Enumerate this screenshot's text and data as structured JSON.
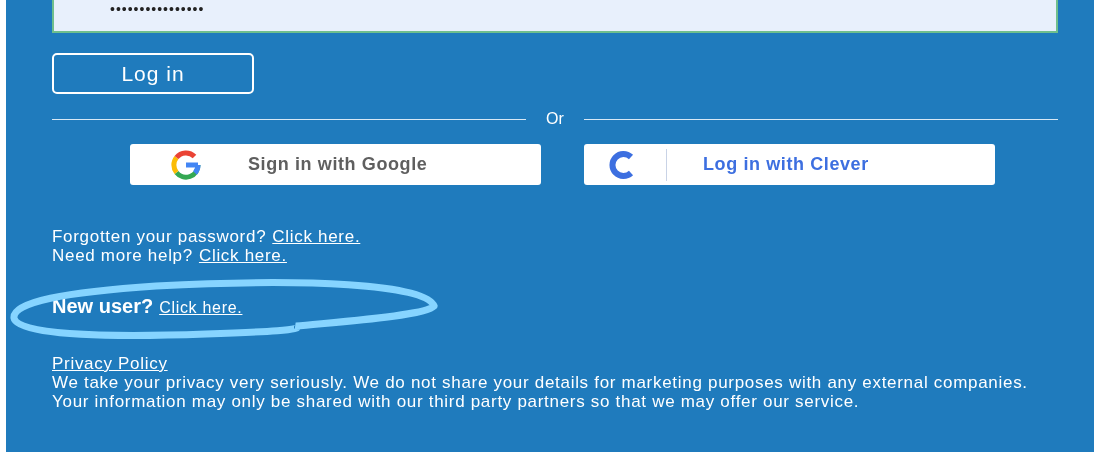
{
  "password_field": {
    "value": "••••••••••••••••"
  },
  "login_button": "Log in",
  "divider_label": "Or",
  "sso_buttons": [
    {
      "kind": "google",
      "label": "Sign in with Google"
    },
    {
      "kind": "clever",
      "label": "Log in with Clever"
    }
  ],
  "help_links": [
    {
      "text": "Forgotten your password?",
      "link": "Click here."
    },
    {
      "text": "Need more help?",
      "link": "Click here."
    }
  ],
  "new_user": {
    "text": "New user?",
    "link": "Click here."
  },
  "privacy": {
    "link": "Privacy Policy",
    "text": "We take your privacy very seriously. We do not share your details for marketing purposes with any external companies. Your information may only be shared with our third party partners so that we may offer our service."
  }
}
